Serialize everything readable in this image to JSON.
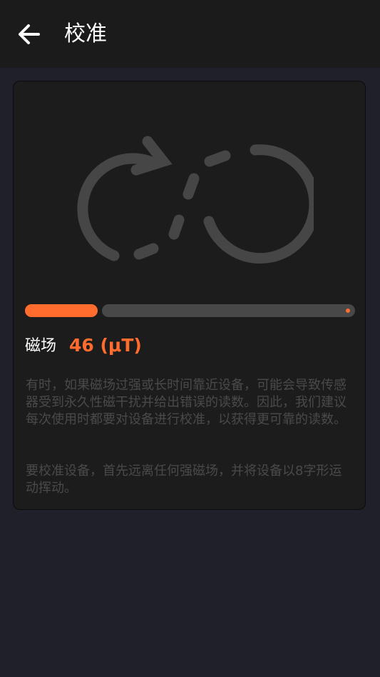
{
  "appbar": {
    "back_icon": "arrow-left-icon",
    "title": "校准"
  },
  "illustration": {
    "icon": "figure-eight-calibration-icon"
  },
  "progress": {
    "value_fraction": 0.22,
    "fill_color": "#ff6c2e",
    "track_color": "#484848"
  },
  "field": {
    "label": "磁场",
    "value": "46 (μT)"
  },
  "description": {
    "paragraph1": "有时，如果磁场过强或长时间靠近设备，可能会导致传感器受到永久性磁干扰并给出错误的读数。因此，我们建议每次使用时都要对设备进行校准，以获得更可靠的读数。",
    "paragraph2": "要校准设备，首先远离任何强磁场，并将设备以8字形运动挥动。"
  },
  "colors": {
    "accent": "#ff6c2e",
    "background": "#1f2029",
    "card": "#1c1c1c",
    "appbar": "#1b1b1b"
  }
}
